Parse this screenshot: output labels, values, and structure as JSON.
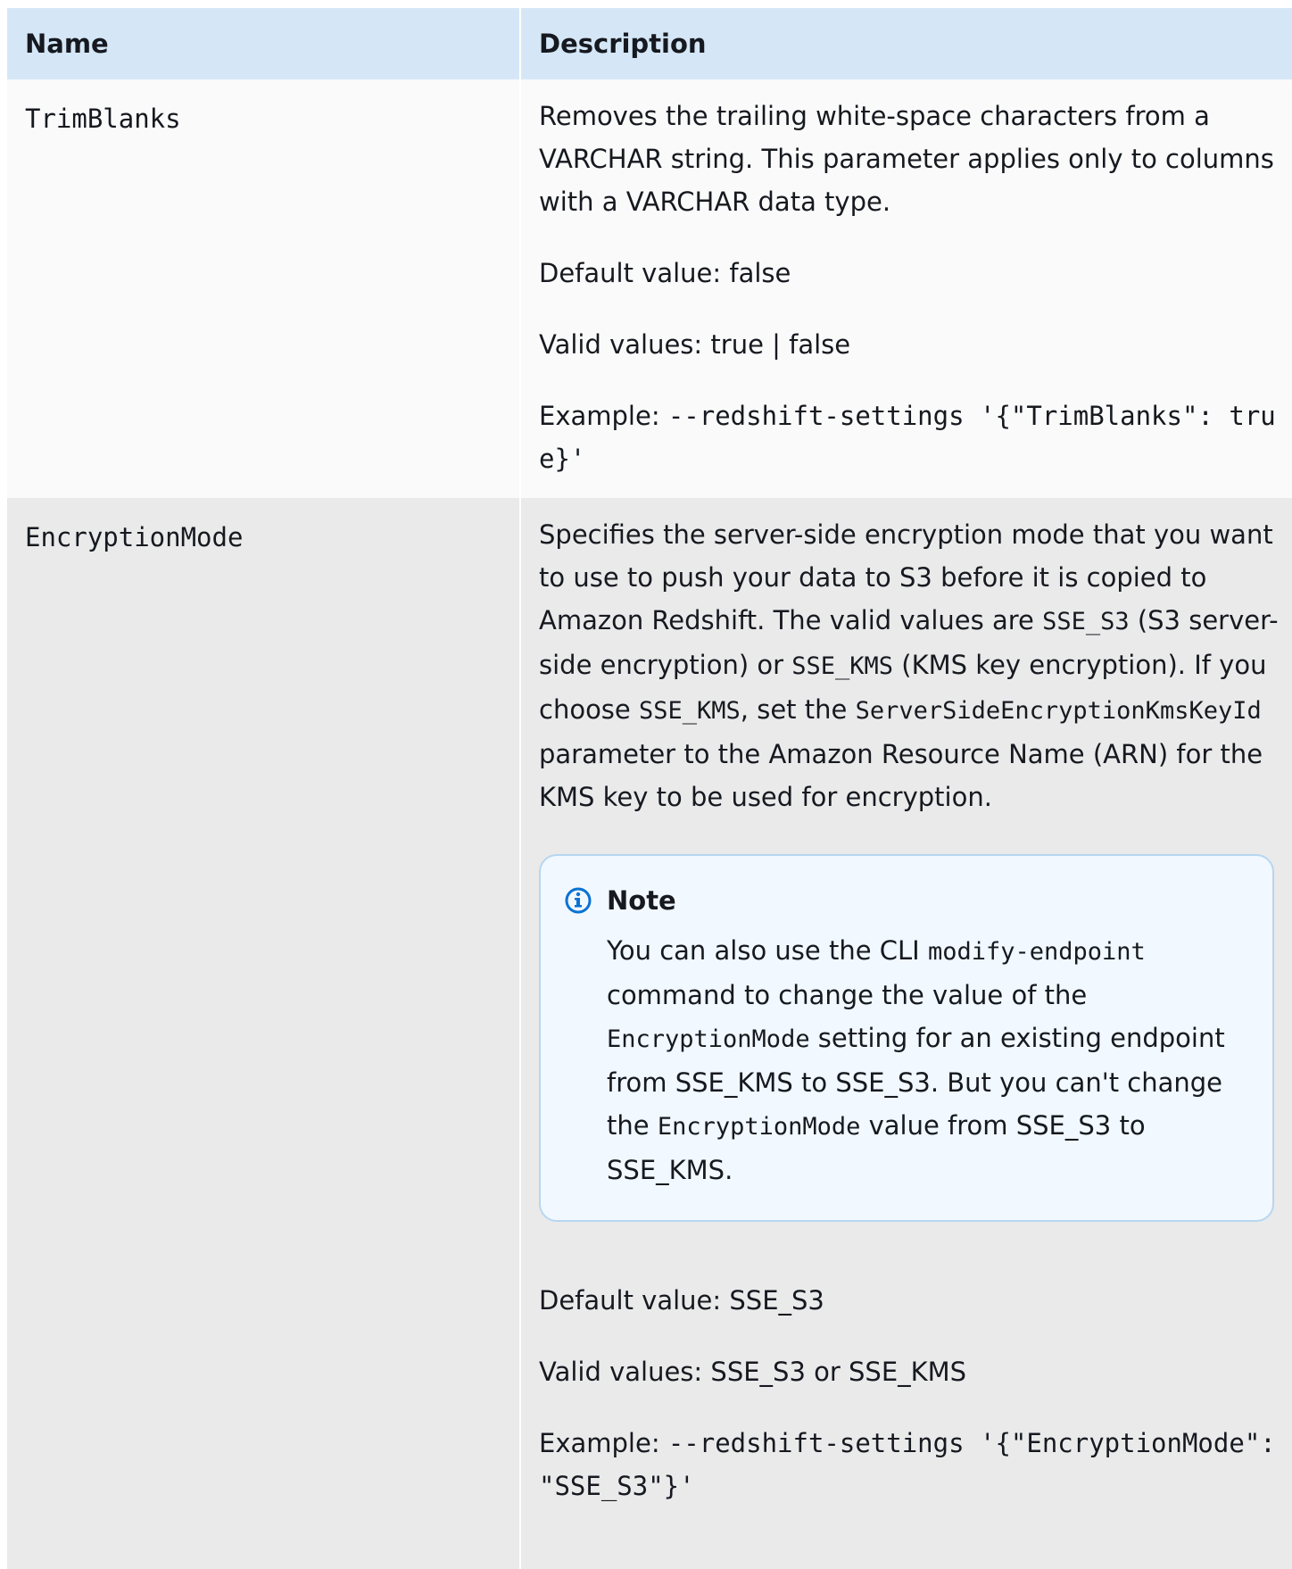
{
  "header": {
    "name": "Name",
    "description": "Description"
  },
  "rows": [
    {
      "name": "TrimBlanks",
      "description": "Removes the trailing white-space characters from a VARCHAR string. This parameter applies only to columns with a VARCHAR data type.",
      "default_value": "Default value: false",
      "valid_values": "Valid values: true | false",
      "example_label": "Example:",
      "example_code": "--redshift-settings '{\"TrimBlanks\": true}'"
    },
    {
      "name": "EncryptionMode",
      "description_parts": {
        "p1": "Specifies the server-side encryption mode that you want to use to push your data to S3 before it is copied to Amazon Redshift. The valid values are ",
        "c1": "SSE_S3",
        "p2": " (S3 server-side encryption) or ",
        "c2": "SSE_KMS",
        "p3": " (KMS key encryption). If you choose ",
        "c3": "SSE_KMS",
        "p4": ", set the ",
        "c4": "ServerSideEncryptionKmsKeyId",
        "p5": " parameter to the Amazon Resource Name (ARN) for the KMS key to be used for encryption."
      },
      "note": {
        "title": "Note",
        "icon": "info-icon",
        "p1": "You can also use the CLI ",
        "c1": "modify-endpoint",
        "p2": " command to change the value of the ",
        "c2": "EncryptionMode",
        "p3": " setting for an existing endpoint from SSE_KMS to SSE_S3. But you can't change the ",
        "c3": "EncryptionMode",
        "p4": " value from SSE_S3 to SSE_KMS."
      },
      "default_value": "Default value: SSE_S3",
      "valid_values": "Valid values: SSE_S3 or SSE_KMS",
      "example_label": "Example:",
      "example_code": "--redshift-settings '{\"EncryptionMode\": \"SSE_S3\"}'"
    }
  ],
  "colors": {
    "header_bg": "#d5e7f7",
    "row1_bg": "#fafafa",
    "row2_bg": "#eaeaeb",
    "note_bg": "#f1f8ff",
    "note_border": "#b7d6f0",
    "info_icon": "#0972d3"
  }
}
